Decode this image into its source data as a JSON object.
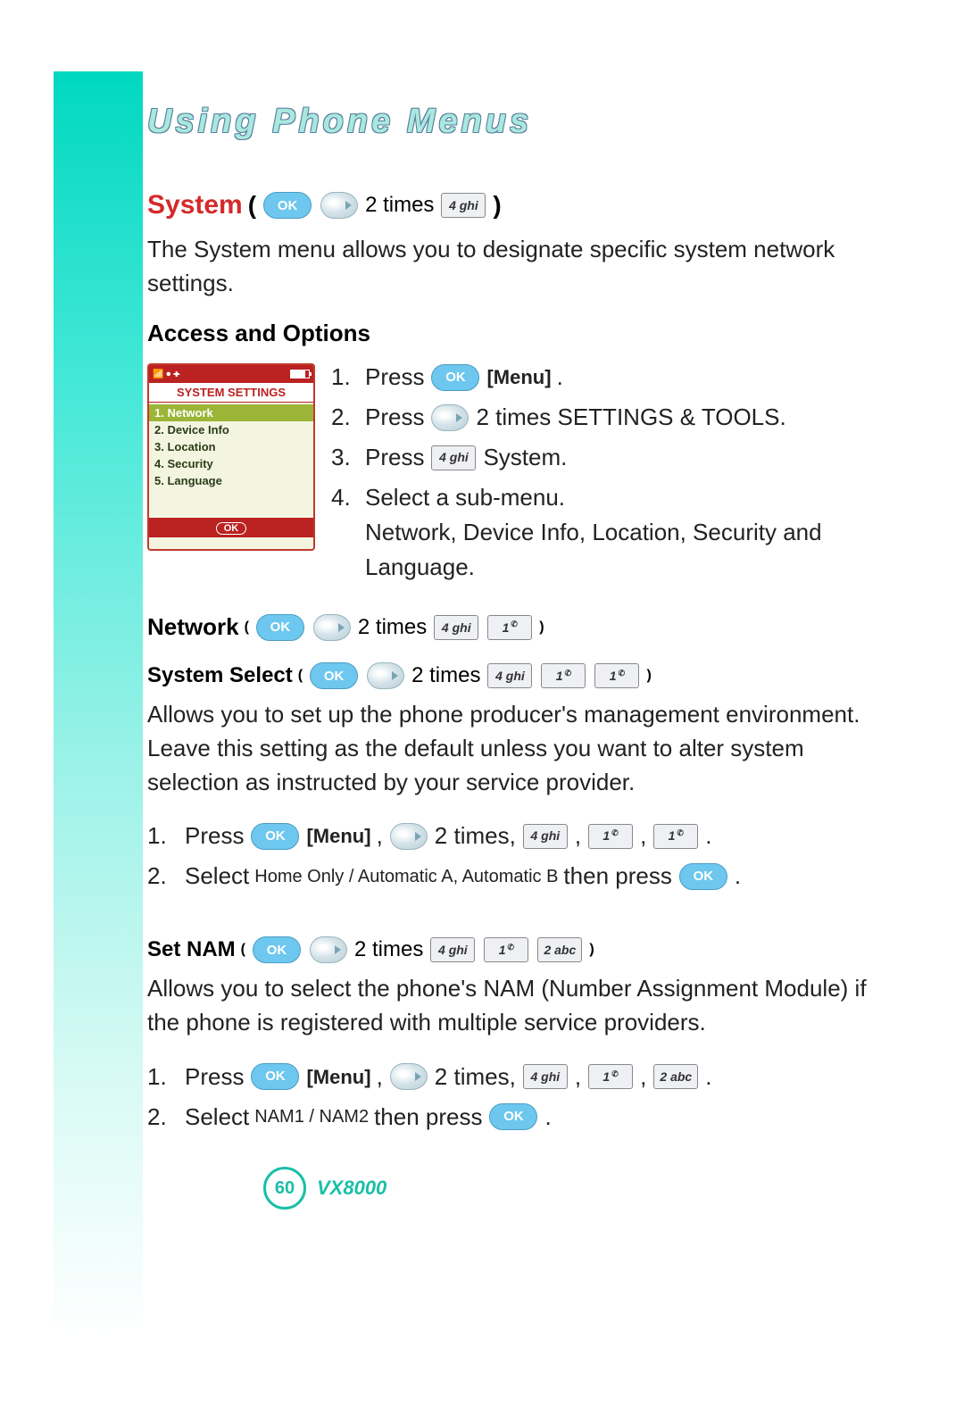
{
  "chapter_title": "Using Phone Menus",
  "page_number": "60",
  "model": "VX8000",
  "labels": {
    "two_times": "2 times",
    "menu": "[Menu]",
    "press": "Press",
    "select_sub": "Select a sub-menu.",
    "comma": ",",
    "period": ".",
    "then_press": "then press",
    "paren_open": "(",
    "paren_close": ")"
  },
  "keys": {
    "ok": "OK",
    "k4": "4 ghi",
    "k1": "1",
    "k2": "2 abc"
  },
  "system": {
    "heading": "System",
    "intro": "The System menu allows you to designate specific system network settings.",
    "access_heading": "Access and Options",
    "screen": {
      "title": "SYSTEM SETTINGS",
      "items": [
        "1. Network",
        "2. Device Info",
        "3. Location",
        "4. Security",
        "5. Language"
      ],
      "softkey": "OK"
    },
    "steps": {
      "s1_num": "1.",
      "s2_num": "2.",
      "s2_tail": "2 times SETTINGS & TOOLS.",
      "s3_num": "3.",
      "s3_tail": "System.",
      "s4_num": "4.",
      "s4_b": "Network, Device Info, Location, Security and Language."
    }
  },
  "network": {
    "heading": "Network"
  },
  "system_select": {
    "heading": "System Select",
    "desc": "Allows you to set up the phone producer's management environment. Leave this setting as the default unless you want to alter system selection as instructed by your service provider.",
    "step1_num": "1.",
    "step1_tail": "2 times,",
    "step2_num": "2.",
    "step2_a": "Select",
    "step2_opts": "Home Only / Automatic A, Automatic B"
  },
  "set_nam": {
    "heading": "Set NAM",
    "desc": "Allows you to select the phone's NAM (Number Assignment Module) if the phone is registered with multiple service providers.",
    "step1_num": "1.",
    "step1_tail": "2 times,",
    "step2_num": "2.",
    "step2_a": "Select",
    "step2_opts": "NAM1 / NAM2"
  }
}
